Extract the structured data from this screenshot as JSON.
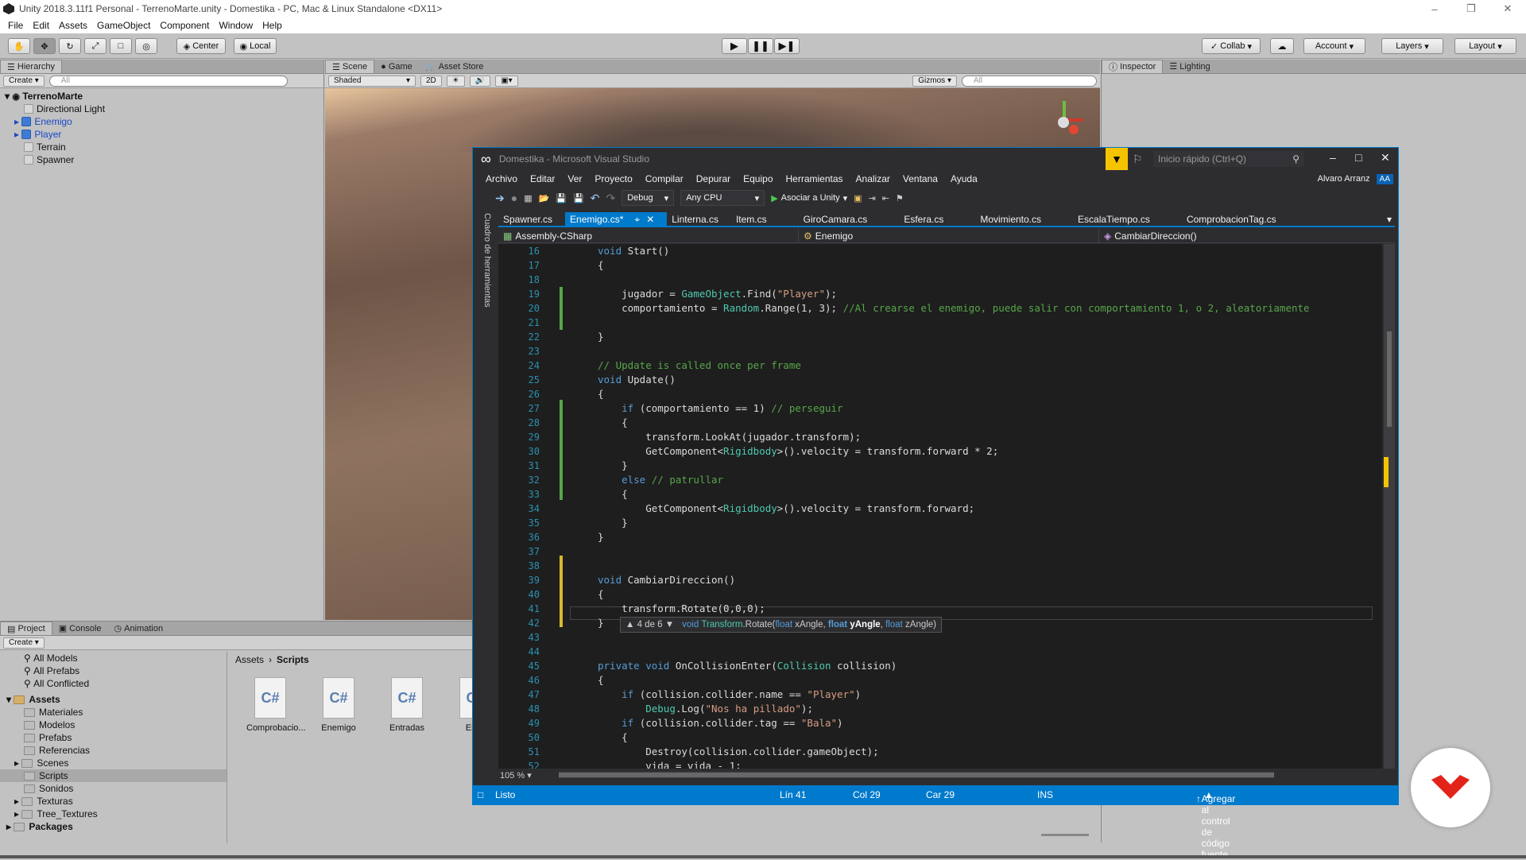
{
  "unity": {
    "title": "Unity 2018.3.11f1 Personal - TerrenoMarte.unity - Domestika - PC, Mac & Linux Standalone <DX11>",
    "menu": [
      "File",
      "Edit",
      "Assets",
      "GameObject",
      "Component",
      "Window",
      "Help"
    ],
    "toolbar": {
      "center": "Center",
      "local": "Local",
      "collab": "Collab",
      "account": "Account",
      "layers": "Layers",
      "layout": "Layout"
    },
    "hierarchy": {
      "tab": "Hierarchy",
      "create": "Create",
      "search_placeholder": "All",
      "scene": "TerrenoMarte",
      "items": [
        {
          "label": "Directional Light"
        },
        {
          "label": "Enemigo"
        },
        {
          "label": "Player"
        },
        {
          "label": "Terrain"
        },
        {
          "label": "Spawner"
        }
      ]
    },
    "scene_tabs": {
      "scene": "Scene",
      "game": "Game",
      "asset_store": "Asset Store",
      "shaded": "Shaded",
      "mode2d": "2D",
      "gizmos": "Gizmos",
      "search_placeholder": "All"
    },
    "inspector_tabs": {
      "inspector": "Inspector",
      "lighting": "Lighting"
    },
    "project": {
      "tabs": [
        "Project",
        "Console",
        "Animation"
      ],
      "create": "Create",
      "favorites": [
        "All Models",
        "All Prefabs",
        "All Conflicted"
      ],
      "assets_label": "Assets",
      "folders": [
        "Materiales",
        "Modelos",
        "Prefabs",
        "Referencias",
        "Scenes",
        "Scripts",
        "Sonidos",
        "Texturas",
        "Tree_Textures"
      ],
      "packages_label": "Packages",
      "breadcrumb": [
        "Assets",
        "Scripts"
      ],
      "files": [
        "Comprobacio...",
        "Enemigo",
        "Entradas",
        "Esca"
      ]
    }
  },
  "vs": {
    "title": "Domestika - Microsoft Visual Studio",
    "quick_launch": "Inicio rápido (Ctrl+Q)",
    "menu": [
      "Archivo",
      "Editar",
      "Ver",
      "Proyecto",
      "Compilar",
      "Depurar",
      "Equipo",
      "Herramientas",
      "Analizar",
      "Ventana",
      "Ayuda"
    ],
    "user": "Alvaro Arranz",
    "user_initials": "AA",
    "config": "Debug",
    "platform": "Any CPU",
    "attach": "Asociar a Unity",
    "toolbox_label": "Cuadro de herramientas",
    "tabs": [
      "Spawner.cs",
      "Enemigo.cs*",
      "Linterna.cs",
      "Item.cs",
      "GiroCamara.cs",
      "Esfera.cs",
      "Movimiento.cs",
      "EscalaTiempo.cs",
      "ComprobacionTag.cs"
    ],
    "nav": {
      "project": "Assembly-CSharp",
      "class": "Enemigo",
      "member": "CambiarDireccion()"
    },
    "tooltip": {
      "count": "4 de 6",
      "sig_type": "void",
      "sig_class": "Transform",
      "sig_method": ".Rotate(",
      "p1t": "float",
      "p1": " xAngle, ",
      "p2t": "float",
      "p2": " yAngle",
      "sep": ", ",
      "p3t": "float",
      "p3": " zAngle)"
    },
    "zoom": "105 %",
    "status": {
      "ready": "Listo",
      "line": "Lín 41",
      "col": "Col 29",
      "car": "Car 29",
      "ins": "INS",
      "scc": "Agregar al control de código fuente"
    }
  }
}
